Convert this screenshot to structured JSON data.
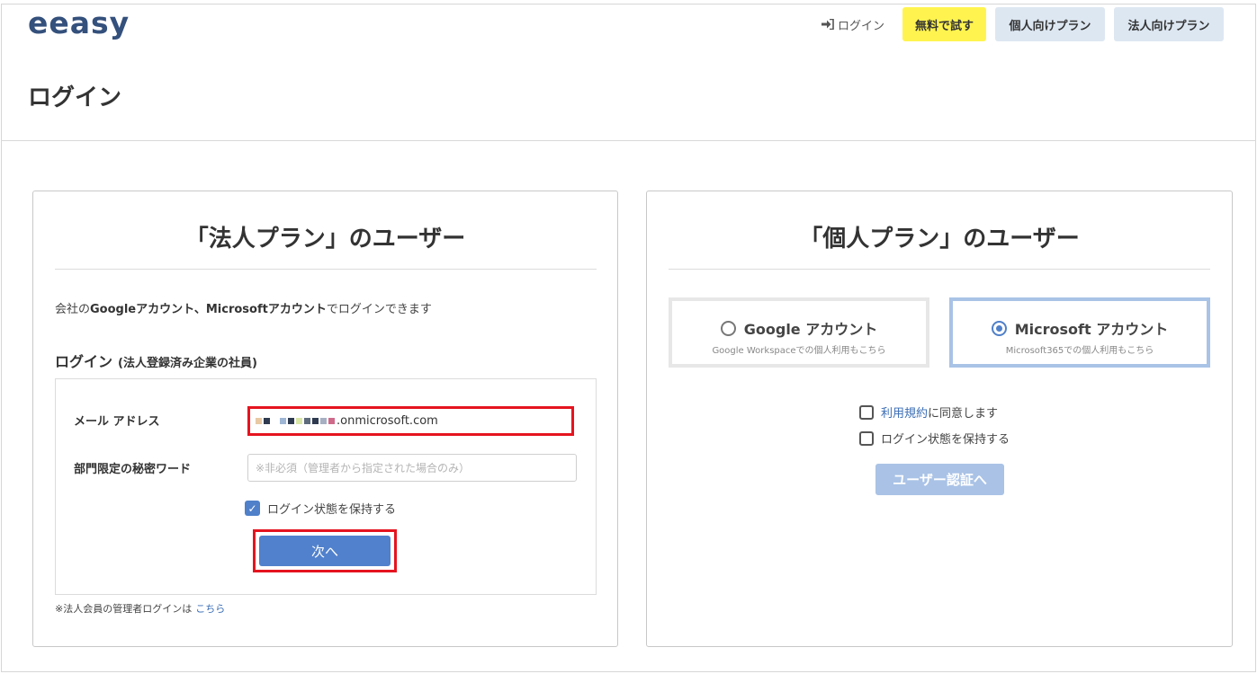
{
  "header": {
    "logo": "eeasy",
    "login_link": "ログイン",
    "login_icon": "sign-in-icon",
    "trial_button": "無料で試す",
    "personal_plan_button": "個人向けプラン",
    "corporate_plan_button": "法人向けプラン"
  },
  "page": {
    "title": "ログイン"
  },
  "corporate": {
    "title": "「法人プラン」のユーザー",
    "desc_prefix": "会社の",
    "desc_bold": "Googleアカウント、Microsoftアカウント",
    "desc_suffix": "でログインできます",
    "login_heading": "ログイン",
    "login_subheading": "(法人登録済み企業の社員)",
    "email_label": "メール アドレス",
    "email_value": ".onmicrosoft.com",
    "password_label": "部門限定の秘密ワード",
    "password_placeholder": "※非必須（管理者から指定された場合のみ）",
    "remember_label": "ログイン状態を保持する",
    "next_button": "次へ",
    "admin_note": "※法人会員の管理者ログインは",
    "admin_link": "こちら"
  },
  "personal": {
    "title": "「個人プラン」のユーザー",
    "google_option": "Google アカウント",
    "google_sub": "Google Workspaceでの個人利用もこちら",
    "ms_option": "Microsoft アカウント",
    "ms_sub": "Microsoft365での個人利用もこちら",
    "terms_link": "利用規約",
    "terms_suffix": "に同意します",
    "remember_label": "ログイン状態を保持する",
    "auth_button": "ユーザー認証へ"
  },
  "colors": {
    "brand": "#34507c",
    "trial_yellow": "#fff44f",
    "nav_button_bg": "#dde7f2",
    "primary_blue": "#5181cc",
    "highlight_red": "#e5141f",
    "disabled_blue": "#a9c2e6"
  }
}
